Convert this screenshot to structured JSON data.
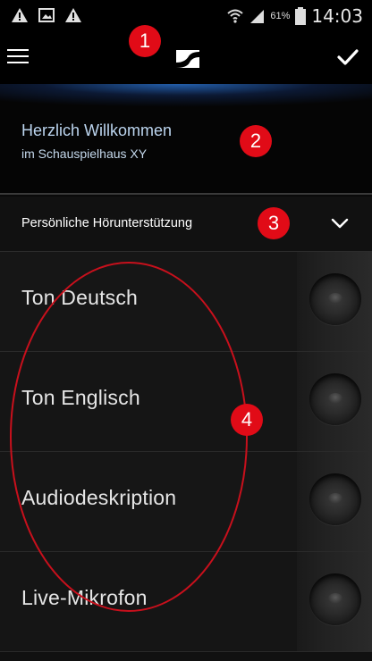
{
  "status_bar": {
    "battery_percent": "61%",
    "time": "14:03"
  },
  "app_bar": {
    "menu_icon": "hamburger-menu-icon",
    "logo_icon": "sennheiser-logo-icon",
    "confirm_icon": "checkmark-icon"
  },
  "welcome": {
    "title": "Herzlich Willkommen",
    "subtitle": "im Schauspielhaus XY"
  },
  "section": {
    "label": "Persönliche Hörunterstützung",
    "icon": "chevron-down-icon"
  },
  "channels": [
    {
      "label": "Ton Deutsch",
      "active": false
    },
    {
      "label": "Ton Englisch",
      "active": false
    },
    {
      "label": "Audiodeskription",
      "active": false
    },
    {
      "label": "Live-Mikrofon",
      "active": false
    }
  ],
  "annotations": {
    "marker_1": "1",
    "marker_2": "2",
    "marker_3": "3",
    "marker_4": "4",
    "color": "#e10b17"
  },
  "colors": {
    "background": "#0a0a0a",
    "welcome_text": "#bcd5ef",
    "accent_glow": "#286ec8"
  }
}
